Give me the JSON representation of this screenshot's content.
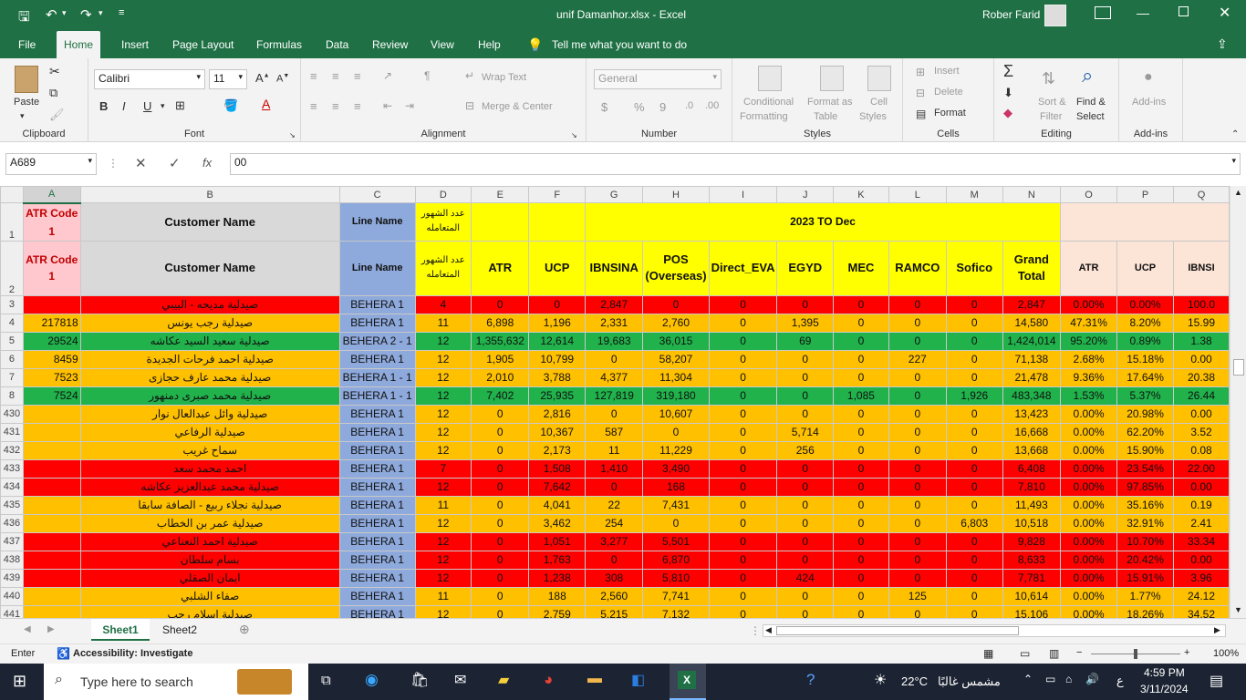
{
  "window": {
    "title": "unif Damanhor.xlsx  -  Excel",
    "user": "Rober Farid"
  },
  "quick_access": {
    "save": "save-icon",
    "undo": "undo-icon",
    "redo": "redo-icon"
  },
  "ribbon_tabs": [
    "File",
    "Home",
    "Insert",
    "Page Layout",
    "Formulas",
    "Data",
    "Review",
    "View",
    "Help"
  ],
  "tell_me": "Tell me what you want to do",
  "ribbon": {
    "clipboard": {
      "paste": "Paste",
      "label": "Clipboard"
    },
    "font": {
      "name": "Calibri",
      "size": "11",
      "label": "Font",
      "bold": "B",
      "italic": "I",
      "underline": "U"
    },
    "alignment": {
      "wrap": "Wrap Text",
      "merge": "Merge & Center",
      "label": "Alignment"
    },
    "number": {
      "format": "General",
      "label": "Number",
      "currency": "$",
      "percent": "%",
      "comma": "9"
    },
    "styles": {
      "cond": "Conditional",
      "cond2": "Formatting",
      "fmt_table": "Format as",
      "fmt_table2": "Table",
      "cell": "Cell",
      "cell2": "Styles",
      "label": "Styles"
    },
    "cells": {
      "insert": "Insert",
      "delete": "Delete",
      "format": "Format",
      "label": "Cells"
    },
    "editing": {
      "sort": "Sort &",
      "sort2": "Filter",
      "find": "Find &",
      "find2": "Select",
      "label": "Editing"
    },
    "addins": {
      "addins": "Add-ins",
      "label": "Add-ins"
    }
  },
  "formula_bar": {
    "name_box": "A689",
    "formula": "00",
    "fx": "fx"
  },
  "columns": [
    "A",
    "B",
    "C",
    "D",
    "E",
    "F",
    "G",
    "H",
    "I",
    "J",
    "K",
    "L",
    "M",
    "N",
    "O",
    "P",
    "Q"
  ],
  "header_row1": {
    "rownum": "1",
    "a": "ATR Code 1",
    "b": "Customer Name",
    "c": "Line Name",
    "d": "عدد الشهور المتعامله",
    "merged": "2023 TO Dec"
  },
  "header_row2": {
    "rownum": "2",
    "cells": [
      "ATR Code 1",
      "Customer Name",
      "Line Name",
      "عدد الشهور المتعامله",
      "ATR",
      "UCP",
      "IBNSINA",
      "POS (Overseas)",
      "Direct_EVA",
      "EGYD",
      "MEC",
      "RAMCO",
      "Sofico",
      "Grand Total",
      "ATR",
      "UCP",
      "IBNSI"
    ]
  },
  "rows": [
    {
      "n": "3",
      "color": "red",
      "a": "",
      "b": "صيدلية مديحه - البيبي",
      "c": "BEHERA 1",
      "d": "4",
      "e": "0",
      "f": "0",
      "g": "2,847",
      "h": "0",
      "i": "0",
      "j": "0",
      "k": "0",
      "l": "0",
      "m": "0",
      "total": "2,847",
      "o": "0.00%",
      "p": "0.00%",
      "q": "100.0"
    },
    {
      "n": "4",
      "color": "org",
      "a": "217818",
      "b": "صيدلية رجب يونس",
      "c": "BEHERA 1",
      "d": "11",
      "e": "6,898",
      "f": "1,196",
      "g": "2,331",
      "h": "2,760",
      "i": "0",
      "j": "1,395",
      "k": "0",
      "l": "0",
      "m": "0",
      "total": "14,580",
      "o": "47.31%",
      "p": "8.20%",
      "q": "15.99"
    },
    {
      "n": "5",
      "color": "grn",
      "a": "29524",
      "b": "صيدلية سعيد السيد عكاشه",
      "c": "BEHERA 2 - 1",
      "d": "12",
      "e": "1,355,632",
      "f": "12,614",
      "g": "19,683",
      "h": "36,015",
      "i": "0",
      "j": "69",
      "k": "0",
      "l": "0",
      "m": "0",
      "total": "1,424,014",
      "o": "95.20%",
      "p": "0.89%",
      "q": "1.38"
    },
    {
      "n": "6",
      "color": "org",
      "a": "8459",
      "b": "صيدلية احمد فرحات الجديدة",
      "c": "BEHERA 1",
      "d": "12",
      "e": "1,905",
      "f": "10,799",
      "g": "0",
      "h": "58,207",
      "i": "0",
      "j": "0",
      "k": "0",
      "l": "227",
      "m": "0",
      "total": "71,138",
      "o": "2.68%",
      "p": "15.18%",
      "q": "0.00"
    },
    {
      "n": "7",
      "color": "org",
      "a": "7523",
      "b": "صيدلية محمد عارف حجازى",
      "c": "BEHERA 1 - 1",
      "d": "12",
      "e": "2,010",
      "f": "3,788",
      "g": "4,377",
      "h": "11,304",
      "i": "0",
      "j": "0",
      "k": "0",
      "l": "0",
      "m": "0",
      "total": "21,478",
      "o": "9.36%",
      "p": "17.64%",
      "q": "20.38"
    },
    {
      "n": "8",
      "color": "grn",
      "a": "7524",
      "b": "صيدلية محمد صبرى دمنهور",
      "c": "BEHERA 1 - 1",
      "d": "12",
      "e": "7,402",
      "f": "25,935",
      "g": "127,819",
      "h": "319,180",
      "i": "0",
      "j": "0",
      "k": "1,085",
      "l": "0",
      "m": "1,926",
      "total": "483,348",
      "o": "1.53%",
      "p": "5.37%",
      "q": "26.44"
    },
    {
      "n": "430",
      "color": "org",
      "a": "",
      "b": "صيدلية وائل عبدالعال نوار",
      "c": "BEHERA 1",
      "d": "12",
      "e": "0",
      "f": "2,816",
      "g": "0",
      "h": "10,607",
      "i": "0",
      "j": "0",
      "k": "0",
      "l": "0",
      "m": "0",
      "total": "13,423",
      "o": "0.00%",
      "p": "20.98%",
      "q": "0.00"
    },
    {
      "n": "431",
      "color": "org",
      "a": "",
      "b": "صيدلية الرفاعي",
      "c": "BEHERA 1",
      "d": "12",
      "e": "0",
      "f": "10,367",
      "g": "587",
      "h": "0",
      "i": "0",
      "j": "5,714",
      "k": "0",
      "l": "0",
      "m": "0",
      "total": "16,668",
      "o": "0.00%",
      "p": "62.20%",
      "q": "3.52"
    },
    {
      "n": "432",
      "color": "org",
      "a": "",
      "b": "سماح غريب",
      "c": "BEHERA 1",
      "d": "12",
      "e": "0",
      "f": "2,173",
      "g": "11",
      "h": "11,229",
      "i": "0",
      "j": "256",
      "k": "0",
      "l": "0",
      "m": "0",
      "total": "13,668",
      "o": "0.00%",
      "p": "15.90%",
      "q": "0.08"
    },
    {
      "n": "433",
      "color": "red",
      "a": "",
      "b": "احمد محمد سعد",
      "c": "BEHERA 1",
      "d": "7",
      "e": "0",
      "f": "1,508",
      "g": "1,410",
      "h": "3,490",
      "i": "0",
      "j": "0",
      "k": "0",
      "l": "0",
      "m": "0",
      "total": "6,408",
      "o": "0.00%",
      "p": "23.54%",
      "q": "22.00"
    },
    {
      "n": "434",
      "color": "red",
      "a": "",
      "b": "صيدلية محمد عبدالعزيز عكاشه",
      "c": "BEHERA 1",
      "d": "12",
      "e": "0",
      "f": "7,642",
      "g": "0",
      "h": "168",
      "i": "0",
      "j": "0",
      "k": "0",
      "l": "0",
      "m": "0",
      "total": "7,810",
      "o": "0.00%",
      "p": "97.85%",
      "q": "0.00"
    },
    {
      "n": "435",
      "color": "org",
      "a": "",
      "b": "صيدلية نجلاء ربيع - الصافة سابقا",
      "c": "BEHERA 1",
      "d": "11",
      "e": "0",
      "f": "4,041",
      "g": "22",
      "h": "7,431",
      "i": "0",
      "j": "0",
      "k": "0",
      "l": "0",
      "m": "0",
      "total": "11,493",
      "o": "0.00%",
      "p": "35.16%",
      "q": "0.19"
    },
    {
      "n": "436",
      "color": "org",
      "a": "",
      "b": "صيدلية عمر بن الخطاب",
      "c": "BEHERA 1",
      "d": "12",
      "e": "0",
      "f": "3,462",
      "g": "254",
      "h": "0",
      "i": "0",
      "j": "0",
      "k": "0",
      "l": "0",
      "m": "6,803",
      "total": "10,518",
      "o": "0.00%",
      "p": "32.91%",
      "q": "2.41"
    },
    {
      "n": "437",
      "color": "red",
      "a": "",
      "b": "صيدلية احمد النعناعي",
      "c": "BEHERA 1",
      "d": "12",
      "e": "0",
      "f": "1,051",
      "g": "3,277",
      "h": "5,501",
      "i": "0",
      "j": "0",
      "k": "0",
      "l": "0",
      "m": "0",
      "total": "9,828",
      "o": "0.00%",
      "p": "10.70%",
      "q": "33.34"
    },
    {
      "n": "438",
      "color": "red",
      "a": "",
      "b": "بسام سلطان",
      "c": "BEHERA 1",
      "d": "12",
      "e": "0",
      "f": "1,763",
      "g": "0",
      "h": "6,870",
      "i": "0",
      "j": "0",
      "k": "0",
      "l": "0",
      "m": "0",
      "total": "8,633",
      "o": "0.00%",
      "p": "20.42%",
      "q": "0.00"
    },
    {
      "n": "439",
      "color": "red",
      "a": "",
      "b": "ايمان الصقلي",
      "c": "BEHERA 1",
      "d": "12",
      "e": "0",
      "f": "1,238",
      "g": "308",
      "h": "5,810",
      "i": "0",
      "j": "424",
      "k": "0",
      "l": "0",
      "m": "0",
      "total": "7,781",
      "o": "0.00%",
      "p": "15.91%",
      "q": "3.96"
    },
    {
      "n": "440",
      "color": "org",
      "a": "",
      "b": "صفاء الشلبي",
      "c": "BEHERA 1",
      "d": "11",
      "e": "0",
      "f": "188",
      "g": "2,560",
      "h": "7,741",
      "i": "0",
      "j": "0",
      "k": "0",
      "l": "125",
      "m": "0",
      "total": "10,614",
      "o": "0.00%",
      "p": "1.77%",
      "q": "24.12"
    },
    {
      "n": "441",
      "color": "org",
      "a": "",
      "b": "صيدلية اسلام رجب",
      "c": "BEHERA 1",
      "d": "12",
      "e": "0",
      "f": "2,759",
      "g": "5,215",
      "h": "7,132",
      "i": "0",
      "j": "0",
      "k": "0",
      "l": "0",
      "m": "0",
      "total": "15,106",
      "o": "0.00%",
      "p": "18.26%",
      "q": "34.52"
    }
  ],
  "sheet_tabs": [
    "Sheet1",
    "Sheet2"
  ],
  "status": {
    "mode": "Enter",
    "accessibility": "Accessibility: Investigate",
    "zoom": "100%"
  },
  "taskbar": {
    "search": "Type here to search",
    "weather": "22°C",
    "weather_text": "مشمس غالبًا",
    "lang": "ع",
    "time": "4:59 PM",
    "date": "3/11/2024"
  },
  "colors": {
    "excel_green": "#1f7145",
    "red_row": "#ff0000",
    "orange_row": "#ffc000",
    "green_row": "#21b24b",
    "header_yellow": "#ffff00",
    "header_blue": "#8ea9db",
    "header_pink": "#ffc7ce",
    "header_peach": "#fce4d6"
  }
}
